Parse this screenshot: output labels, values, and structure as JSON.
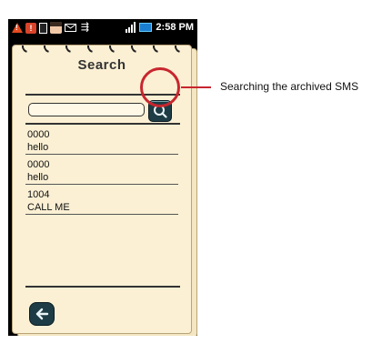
{
  "status_bar": {
    "time": "2:58 PM",
    "icons": [
      "warning-icon",
      "notification-icon",
      "sd-card-icon",
      "contact-photo-icon",
      "email-icon",
      "usb-icon",
      "signal-icon",
      "battery-icon"
    ]
  },
  "screen": {
    "title": "Search",
    "search": {
      "value": "",
      "placeholder": ""
    },
    "messages": [
      {
        "number": "0000",
        "text": "hello"
      },
      {
        "number": "0000",
        "text": "hello"
      },
      {
        "number": "1004",
        "text": "CALL ME"
      }
    ],
    "back_icon": "back-arrow-icon",
    "search_icon": "magnifier-icon"
  },
  "annotation": {
    "label": "Searching the archived SMS",
    "color": "#c8262e"
  },
  "colors": {
    "paper": "#fbf0d4",
    "button": "#1d3c45"
  }
}
